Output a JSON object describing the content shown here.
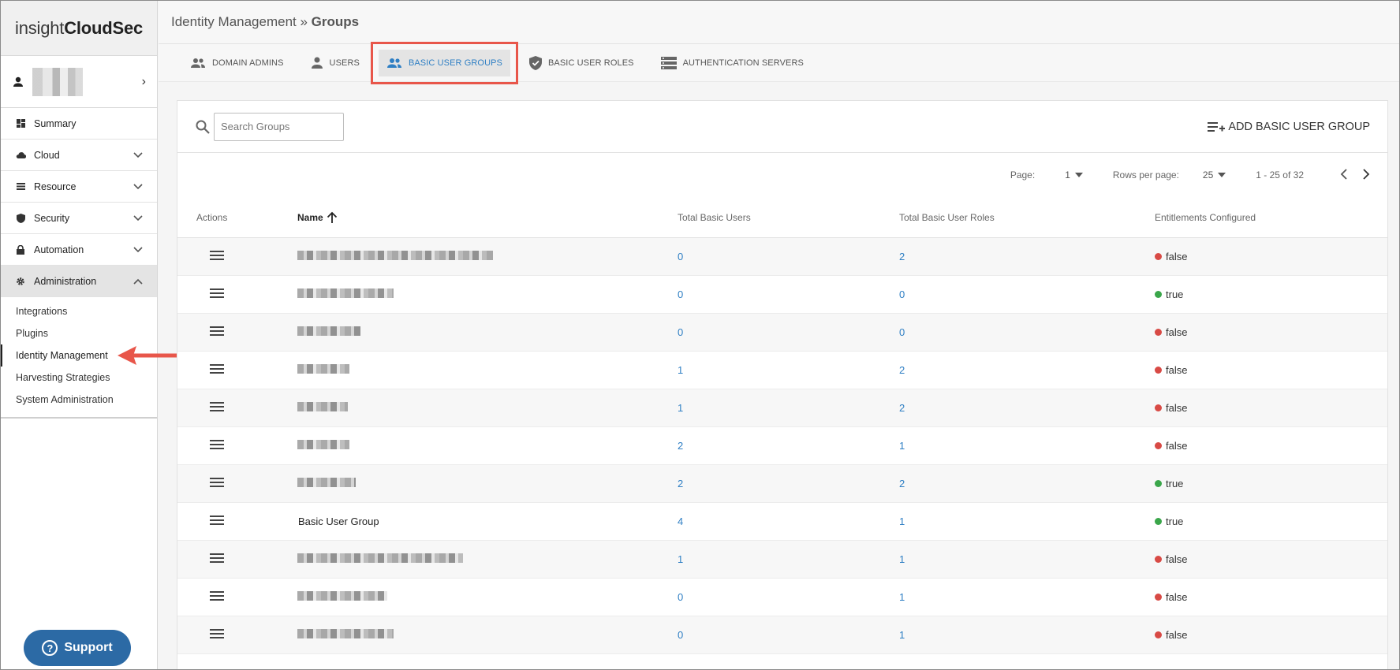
{
  "app": {
    "logo_light": "insight",
    "logo_bold": "CloudSec"
  },
  "sidebar": {
    "items": [
      {
        "label": "Summary",
        "icon": "dashboard-icon",
        "has_chevron": false
      },
      {
        "label": "Cloud",
        "icon": "cloud-icon",
        "has_chevron": true
      },
      {
        "label": "Resource",
        "icon": "list-icon",
        "has_chevron": true
      },
      {
        "label": "Security",
        "icon": "shield-icon",
        "has_chevron": true
      },
      {
        "label": "Automation",
        "icon": "lock-icon",
        "has_chevron": true
      },
      {
        "label": "Administration",
        "icon": "gear-icon",
        "has_chevron": true,
        "expanded": true
      }
    ],
    "subitems": [
      {
        "label": "Integrations"
      },
      {
        "label": "Plugins"
      },
      {
        "label": "Identity Management",
        "current": true
      },
      {
        "label": "Harvesting Strategies"
      },
      {
        "label": "System Administration"
      }
    ],
    "support_label": "Support"
  },
  "header": {
    "breadcrumb_parent": "Identity Management",
    "separator": " » ",
    "breadcrumb_current": "Groups"
  },
  "tabs": [
    {
      "label": "DOMAIN ADMINS",
      "icon": "group-icon"
    },
    {
      "label": "USERS",
      "icon": "person-icon"
    },
    {
      "label": "BASIC USER GROUPS",
      "icon": "group-icon",
      "active": true
    },
    {
      "label": "BASIC USER ROLES",
      "icon": "shield-check-icon"
    },
    {
      "label": "AUTHENTICATION SERVERS",
      "icon": "server-icon"
    }
  ],
  "toolbar": {
    "search_placeholder": "Search Groups",
    "add_label": "ADD BASIC USER GROUP"
  },
  "pagination": {
    "page_label": "Page:",
    "page_value": "1",
    "rows_label": "Rows per page:",
    "rows_value": "25",
    "range": "1 - 25 of 32"
  },
  "table": {
    "columns": [
      "Actions",
      "Name",
      "Total Basic Users",
      "Total Basic User Roles",
      "Entitlements Configured"
    ],
    "rows": [
      {
        "name": "",
        "redacted_width": 248,
        "users": "0",
        "roles": "2",
        "entitlements": "false"
      },
      {
        "name": "",
        "redacted_width": 122,
        "users": "0",
        "roles": "0",
        "entitlements": "true"
      },
      {
        "name": "",
        "redacted_width": 80,
        "users": "0",
        "roles": "0",
        "entitlements": "false"
      },
      {
        "name": "",
        "redacted_width": 66,
        "users": "1",
        "roles": "2",
        "entitlements": "false"
      },
      {
        "name": "",
        "redacted_width": 64,
        "users": "1",
        "roles": "2",
        "entitlements": "false"
      },
      {
        "name": "",
        "redacted_width": 66,
        "users": "2",
        "roles": "1",
        "entitlements": "false"
      },
      {
        "name": "",
        "redacted_width": 74,
        "users": "2",
        "roles": "2",
        "entitlements": "true"
      },
      {
        "name": "Basic User Group",
        "redacted_width": 0,
        "users": "4",
        "roles": "1",
        "entitlements": "true"
      },
      {
        "name": "",
        "redacted_width": 210,
        "users": "1",
        "roles": "1",
        "entitlements": "false"
      },
      {
        "name": "",
        "redacted_width": 114,
        "users": "0",
        "roles": "1",
        "entitlements": "false"
      },
      {
        "name": "",
        "redacted_width": 122,
        "users": "0",
        "roles": "1",
        "entitlements": "false"
      }
    ]
  },
  "colors": {
    "accent": "#2f7fc4",
    "highlight_box": "#e8564a",
    "status_false": "#d84a45",
    "status_true": "#3aa64a",
    "support_bg": "#2c6aa5"
  }
}
